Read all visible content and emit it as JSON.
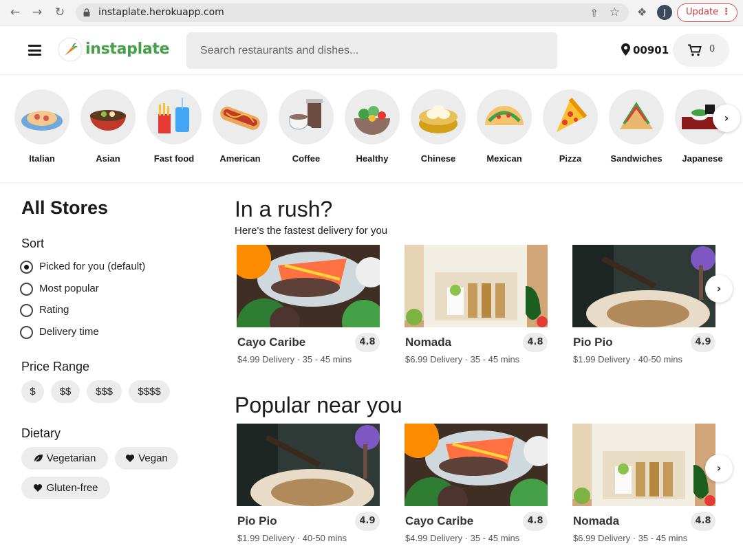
{
  "browser": {
    "url": "instaplate.herokuapp.com",
    "profile_initial": "J",
    "update_label": "Update"
  },
  "header": {
    "brand": "instaplate",
    "search_placeholder": "Search restaurants and dishes...",
    "zip": "00901",
    "cart_count": "0"
  },
  "categories": [
    {
      "label": "Italian",
      "icon": "pasta-icon"
    },
    {
      "label": "Asian",
      "icon": "ramen-bowl-icon"
    },
    {
      "label": "Fast food",
      "icon": "fries-drink-icon"
    },
    {
      "label": "American",
      "icon": "hotdog-icon"
    },
    {
      "label": "Coffee",
      "icon": "coffee-cup-icon"
    },
    {
      "label": "Healthy",
      "icon": "salad-bowl-icon"
    },
    {
      "label": "Chinese",
      "icon": "dumpling-basket-icon"
    },
    {
      "label": "Mexican",
      "icon": "taco-icon"
    },
    {
      "label": "Pizza",
      "icon": "pizza-slice-icon"
    },
    {
      "label": "Sandwiches",
      "icon": "sandwich-icon"
    },
    {
      "label": "Japanese",
      "icon": "sushi-icon"
    }
  ],
  "sidebar": {
    "title": "All Stores",
    "sort_heading": "Sort",
    "sort_options": [
      {
        "label": "Picked for you (default)",
        "selected": true
      },
      {
        "label": "Most popular",
        "selected": false
      },
      {
        "label": "Rating",
        "selected": false
      },
      {
        "label": "Delivery time",
        "selected": false
      }
    ],
    "price_heading": "Price Range",
    "prices": [
      "$",
      "$$",
      "$$$",
      "$$$$"
    ],
    "dietary_heading": "Dietary",
    "dietary": [
      {
        "label": "Vegetarian",
        "icon": "leaf-icon"
      },
      {
        "label": "Vegan",
        "icon": "heart-icon"
      },
      {
        "label": "Gluten-free",
        "icon": "heart-icon"
      }
    ]
  },
  "rush": {
    "title": "In a rush?",
    "subtitle": "Here's the fastest delivery for you",
    "stores": [
      {
        "name": "Cayo Caribe",
        "rating": "4.8",
        "meta": "$4.99 Delivery · 35 - 45 mins",
        "photo": "fish-platter-photo"
      },
      {
        "name": "Nomada",
        "rating": "4.8",
        "meta": "$6.99 Delivery · 35 - 45 mins",
        "photo": "taco-box-photo"
      },
      {
        "name": "Pio Pio",
        "rating": "4.9",
        "meta": "$1.99 Delivery · 40-50 mins",
        "photo": "rice-plate-photo"
      }
    ]
  },
  "popular": {
    "title": "Popular near you",
    "stores": [
      {
        "name": "Pio Pio",
        "rating": "4.9",
        "meta": "$1.99 Delivery · 40-50 mins",
        "photo": "rice-plate-photo"
      },
      {
        "name": "Cayo Caribe",
        "rating": "4.8",
        "meta": "$4.99 Delivery · 35 - 45 mins",
        "photo": "fish-platter-photo"
      },
      {
        "name": "Nomada",
        "rating": "4.8",
        "meta": "$6.99 Delivery · 35 - 45 mins",
        "photo": "taco-box-photo"
      }
    ]
  },
  "colors": {
    "brand_green": "#43a047",
    "carrot_orange": "#f07c1a",
    "update_red": "#c23b3b",
    "pill_gray": "#ececec"
  }
}
